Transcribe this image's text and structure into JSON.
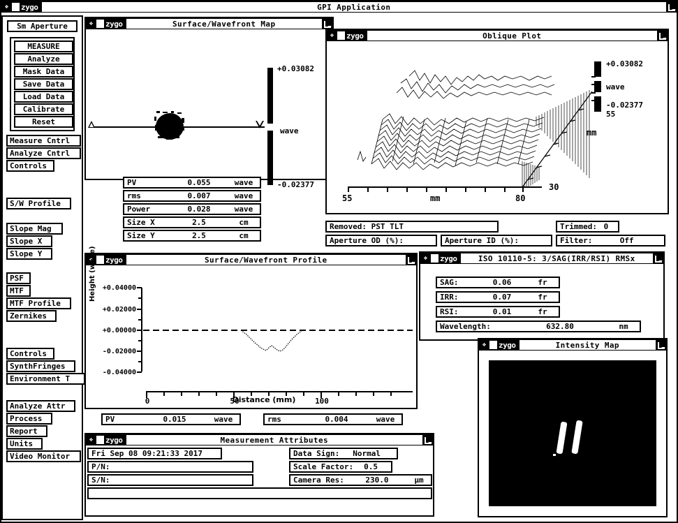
{
  "app": {
    "title": "GPI Application",
    "vendor_logo": "zygo"
  },
  "sidebar": {
    "aperture_button": "Sm Aperture",
    "action_group": [
      "MEASURE",
      "Analyze",
      "Mask Data",
      "Save Data",
      "Load Data",
      "Calibrate",
      "Reset"
    ],
    "groups": [
      {
        "items": [
          "Measure Cntrl",
          "Analyze Cntrl",
          "Controls"
        ]
      },
      {
        "items": [
          "S/W Profile"
        ]
      },
      {
        "items": [
          "Slope Mag",
          "Slope X",
          "Slope Y"
        ]
      },
      {
        "items": [
          "PSF",
          "MTF",
          "MTF Profile",
          "Zernikes"
        ]
      },
      {
        "items": [
          "Controls",
          "SynthFringes",
          "Environment T"
        ]
      },
      {
        "items": [
          "Analyze Attr",
          "Process",
          "Report",
          "Units",
          "Video Monitor"
        ]
      }
    ]
  },
  "surface_map": {
    "title": "Surface/Wavefront Map",
    "scale_max": "+0.03082",
    "scale_unit": "wave",
    "scale_min": "-0.02377"
  },
  "stats": [
    {
      "label": "PV",
      "value": "0.055",
      "unit": "wave"
    },
    {
      "label": "rms",
      "value": "0.007",
      "unit": "wave"
    },
    {
      "label": "Power",
      "value": "0.028",
      "unit": "wave"
    },
    {
      "label": "Size X",
      "value": "2.5",
      "unit": "cm"
    },
    {
      "label": "Size Y",
      "value": "2.5",
      "unit": "cm"
    }
  ],
  "oblique": {
    "title": "Oblique Plot",
    "scale_max": "+0.03082",
    "scale_unit": "wave",
    "scale_min": "-0.02377",
    "depth_label": "55",
    "x_start": "55",
    "x_end": "80",
    "x_unit": "mm",
    "y_unit": "mm",
    "y_value": "30"
  },
  "removed_row": {
    "removed": "Removed: PST TLT",
    "trimmed_label": "Trimmed:",
    "trimmed_value": "0",
    "aperture_od": "Aperture OD (%):",
    "aperture_id": "Aperture ID (%):",
    "filter_label": "Filter:",
    "filter_value": "Off"
  },
  "profile": {
    "title": "Surface/Wavefront Profile",
    "ylabel": "Height (wave)",
    "xlabel": "Distance (mm)",
    "yticks": [
      "+0.04000",
      "+0.02000",
      "+0.00000",
      "-0.02000",
      "-0.04000"
    ],
    "xticks": [
      "0",
      "50",
      "100"
    ],
    "stats": [
      {
        "label": "PV",
        "value": "0.015",
        "unit": "wave"
      },
      {
        "label": "rms",
        "value": "0.004",
        "unit": "wave"
      }
    ]
  },
  "chart_data": {
    "type": "line",
    "title": "Surface/Wavefront Profile",
    "xlabel": "Distance (mm)",
    "ylabel": "Height (wave)",
    "xlim": [
      0,
      145
    ],
    "ylim": [
      -0.04,
      0.04
    ],
    "grid": false,
    "legend": "none",
    "series": [
      {
        "name": "zero reference",
        "style": "dashed",
        "x": [
          0,
          145
        ],
        "y": [
          0.0,
          0.0
        ]
      },
      {
        "name": "surface height",
        "style": "dotted",
        "x": [
          55,
          57,
          59,
          61,
          63,
          65,
          67,
          69,
          71,
          73,
          75,
          77,
          79,
          81
        ],
        "y": [
          -0.0005,
          -0.0025,
          -0.0045,
          -0.0075,
          -0.0105,
          -0.0118,
          -0.01,
          -0.0115,
          -0.0118,
          -0.0095,
          -0.006,
          -0.003,
          -0.0005,
          0.0
        ]
      }
    ]
  },
  "iso": {
    "title": "ISO 10110-5: 3/SAG(IRR/RSI) RMSx",
    "rows": [
      {
        "label": "SAG:",
        "value": "0.06",
        "unit": "fr"
      },
      {
        "label": "IRR:",
        "value": "0.07",
        "unit": "fr"
      },
      {
        "label": "RSI:",
        "value": "0.01",
        "unit": "fr"
      }
    ],
    "wavelength_label": "Wavelength:",
    "wavelength_value": "632.80",
    "wavelength_unit": "nm"
  },
  "intensity": {
    "title": "Intensity Map"
  },
  "measurement": {
    "title": "Measurement Attributes",
    "timestamp": "Fri Sep 08 09:21:33 2017",
    "pn_label": "P/N:",
    "pn_value": "",
    "sn_label": "S/N:",
    "sn_value": "",
    "note_value": "",
    "data_sign_label": "Data Sign:",
    "data_sign_value": "Normal",
    "scale_factor_label": "Scale Factor:",
    "scale_factor_value": "0.5",
    "camera_res_label": "Camera Res:",
    "camera_res_value": "230.0",
    "camera_res_unit": "µm"
  },
  "colors": {
    "background": "#ffffff",
    "foreground": "#000000",
    "titlebar": "#000000"
  }
}
